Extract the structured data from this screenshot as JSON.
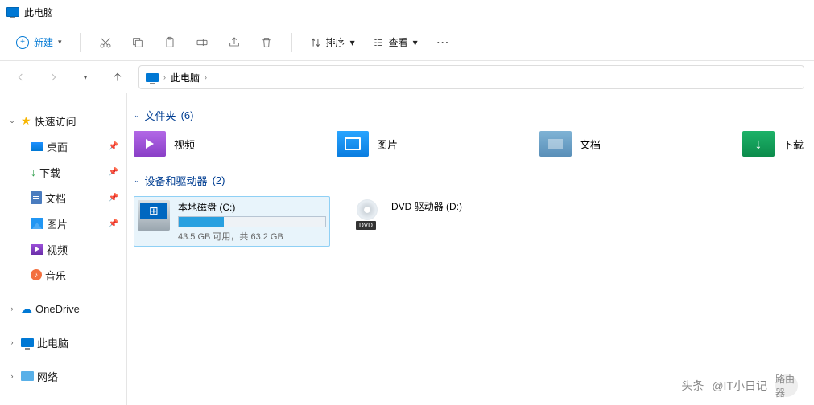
{
  "window": {
    "title": "此电脑"
  },
  "toolbar": {
    "new_label": "新建",
    "sort_label": "排序",
    "view_label": "查看"
  },
  "breadcrumb": {
    "root": "此电脑"
  },
  "sidebar": {
    "quick": "快速访问",
    "items": [
      {
        "label": "桌面",
        "pinned": true
      },
      {
        "label": "下载",
        "pinned": true
      },
      {
        "label": "文档",
        "pinned": true
      },
      {
        "label": "图片",
        "pinned": true
      },
      {
        "label": "视频",
        "pinned": false
      },
      {
        "label": "音乐",
        "pinned": false
      }
    ],
    "onedrive": "OneDrive",
    "thispc": "此电脑",
    "network": "网络"
  },
  "sections": {
    "folders": {
      "title": "文件夹",
      "count": "(6)"
    },
    "devices": {
      "title": "设备和驱动器",
      "count": "(2)"
    }
  },
  "folders": [
    {
      "label": "视频"
    },
    {
      "label": "图片"
    },
    {
      "label": "文档"
    },
    {
      "label": "下载"
    }
  ],
  "drives": [
    {
      "name": "本地磁盘 (C:)",
      "sub": "43.5 GB 可用，共 63.2 GB",
      "fill_pct": 31
    },
    {
      "name": "DVD 驱动器 (D:)"
    }
  ],
  "watermark": {
    "left": "头条",
    "right": "@IT小日记",
    "badge": "路由器"
  }
}
